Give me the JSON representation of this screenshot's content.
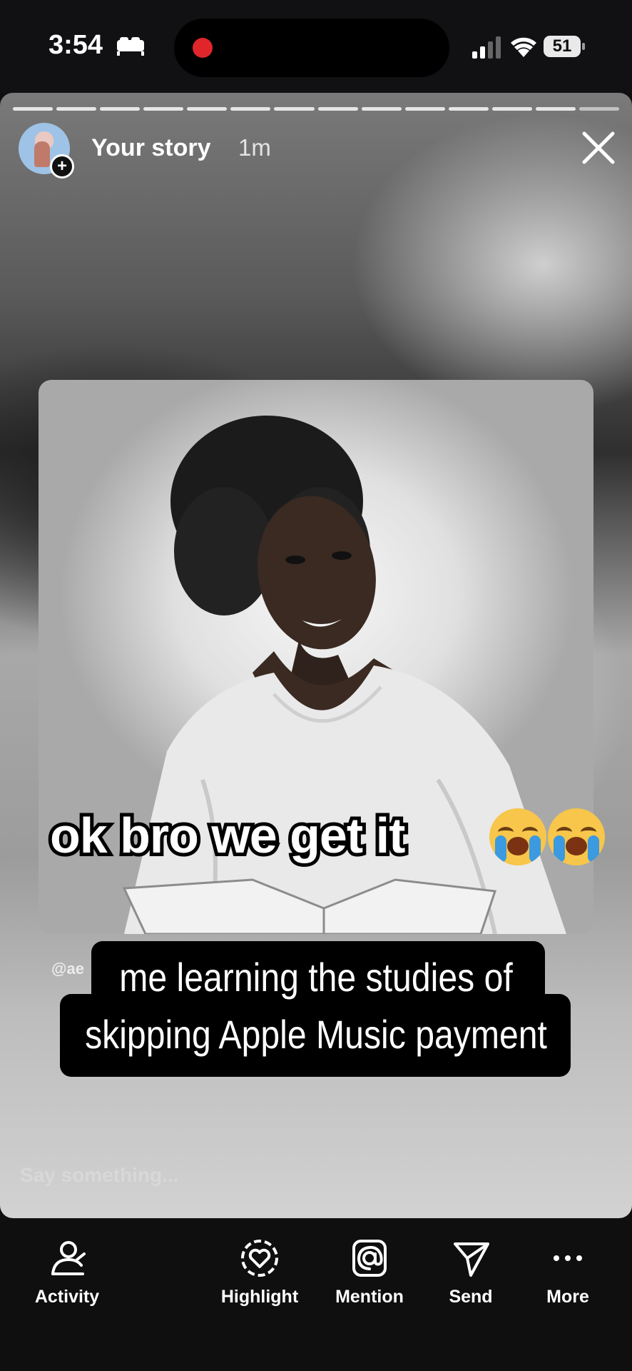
{
  "status_bar": {
    "time": "3:54",
    "battery": "51"
  },
  "story": {
    "user": "Your story",
    "time_ago": "1m",
    "progress_segments": 14,
    "caption_main": "ok bro we get it",
    "handle": "@ae",
    "subtitle_line1": "me learning the studies of",
    "subtitle_line2": "skipping Apple Music payment",
    "reply_placeholder": "Say something..."
  },
  "bottom_bar": {
    "items": [
      {
        "label": "Activity",
        "icon": "activity-icon"
      },
      {
        "label": "Highlight",
        "icon": "highlight-icon"
      },
      {
        "label": "Mention",
        "icon": "mention-icon"
      },
      {
        "label": "Send",
        "icon": "send-icon"
      },
      {
        "label": "More",
        "icon": "more-icon"
      }
    ]
  }
}
